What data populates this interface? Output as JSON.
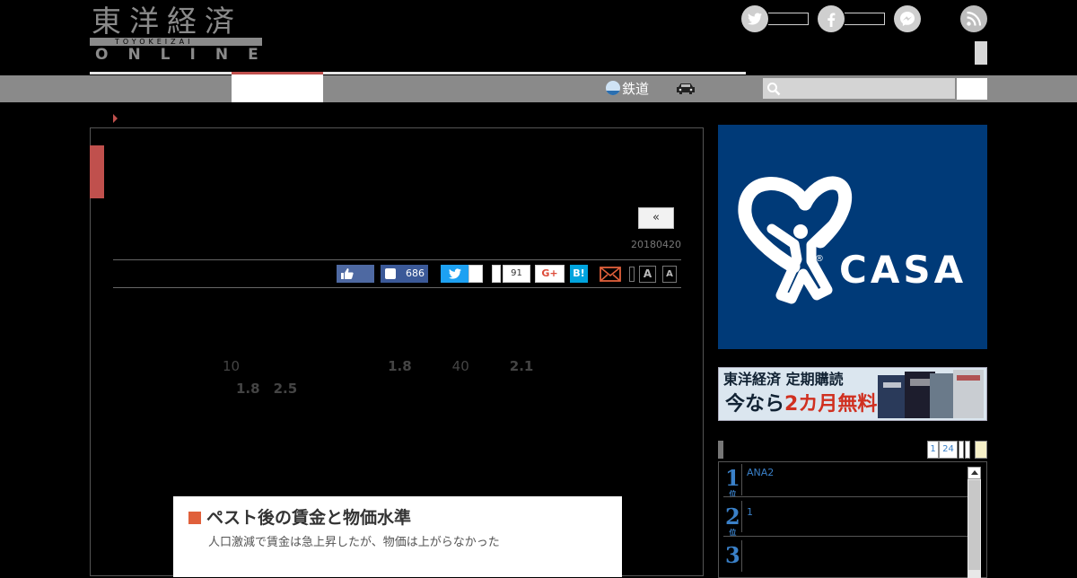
{
  "brand": {
    "logo_kanji": "東洋経済",
    "logo_roman": "TOYOKEIZAI",
    "logo_online": "ONLINE"
  },
  "header": {
    "social": [
      "twitter-icon",
      "facebook-icon",
      "messenger-icon"
    ],
    "rss": "rss-icon"
  },
  "nav": {
    "rail_label": "鉄道",
    "car_icon": "car-icon",
    "search_placeholder": ""
  },
  "article": {
    "prev_label": "«",
    "date": "20180420",
    "share": {
      "facebook_count": "686",
      "pocket_count": "91",
      "gplus_label": "G+",
      "hatena_label": "B!",
      "font_large": "A",
      "font_small": "A"
    },
    "p1_a": "10",
    "p1_b": "1.8",
    "p1_c": "40",
    "p1_d": "2.1",
    "p1_e": "1.8",
    "p1_f": "2.5",
    "figure": {
      "title": "ペスト後の賃金と物価水準",
      "subtitle": "人口激減で賃金は急上昇したが、物価は上がらなかった"
    }
  },
  "sidebar": {
    "casa_text": "CASA",
    "casa_reg": "®",
    "sub_line1": "東洋経済 定期購読",
    "sub_line2_a": "今なら",
    "sub_line2_b": "2カ月無料",
    "ranking": {
      "tabs": [
        "1",
        "24"
      ],
      "items": [
        {
          "rank": "1",
          "suffix": "位",
          "title": "ANA2"
        },
        {
          "rank": "2",
          "suffix": "位",
          "title": "1"
        },
        {
          "rank": "3",
          "suffix": "",
          "title": ""
        }
      ]
    }
  },
  "colors": {
    "accent": "#c0504d",
    "nav_bg": "#8a8a8a",
    "casa_blue": "#003a78",
    "link": "#3a80c8"
  }
}
